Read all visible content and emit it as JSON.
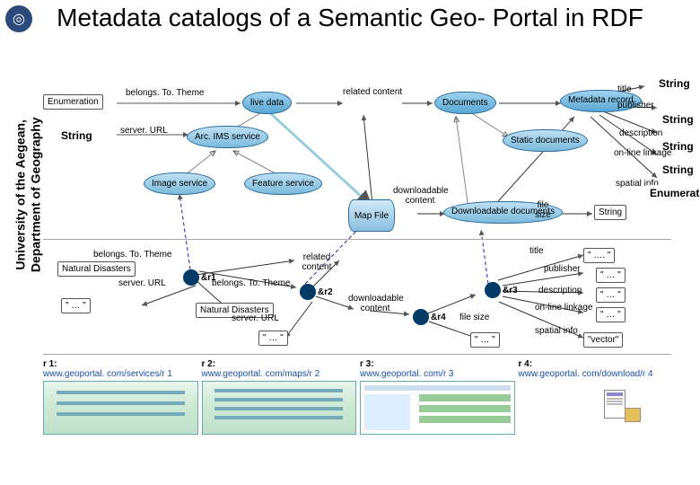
{
  "title": "Metadata catalogs of a Semantic Geo- Portal in RDF",
  "side": {
    "l1": "University of the Aegean,",
    "l2": "Department of Geography"
  },
  "classes": {
    "enumeration": "Enumeration",
    "string": "String",
    "live_data": "live data",
    "related_content": "related content",
    "documents": "Documents",
    "metadata_record": "Metadata record",
    "arcims": "Arc. IMS service",
    "static_documents": "Static documents",
    "image_service": "Image service",
    "feature_service": "Feature service",
    "map_file": "Map File",
    "downloadable_content": "downloadable content",
    "downloadable_documents": "Downloadable documents",
    "file_size": "file size"
  },
  "props": {
    "belongsToTheme": "belongs. To. Theme",
    "serverURL": "server. URL",
    "title": "title",
    "publisher": "publisher",
    "description": "description",
    "online_linkage": "on-line linkage",
    "spatial_info": "spatial info"
  },
  "inst": {
    "natural_disasters": "Natural Disasters",
    "r1": "&r1",
    "r2": "&r2",
    "r3": "&r3",
    "r4": "&r4",
    "dots4": "\" …. \"",
    "dots3": "\" … \"",
    "dotsq": "\" … \"",
    "vector": "\"vector\""
  },
  "refs": {
    "r1_label": "r 1:",
    "r1_url": "www.geoportal. com/services/r 1",
    "r2_label": "r 2:",
    "r2_url": "www.geoportal. com/maps/r 2",
    "r3_label": "r 3:",
    "r3_url": "www.geoportal. com/r 3",
    "r4_label": "r 4:",
    "r4_url": "www.geoportal. com/download/r 4"
  }
}
